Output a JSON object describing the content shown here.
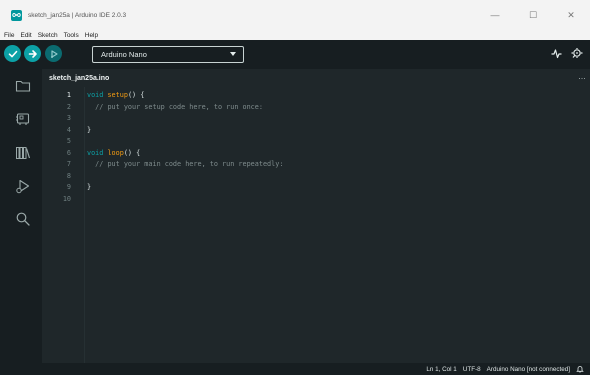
{
  "window": {
    "title": "sketch_jan25a | Arduino IDE 2.0.3",
    "controls": {
      "minimize": "—",
      "maximize": "☐",
      "close": "✕"
    }
  },
  "menu": [
    "File",
    "Edit",
    "Sketch",
    "Tools",
    "Help"
  ],
  "toolbar": {
    "board": "Arduino Nano",
    "icons": [
      "verify-icon",
      "upload-icon",
      "debug-icon",
      "serial-plotter-icon",
      "serial-monitor-icon"
    ]
  },
  "sidebar": {
    "icons": [
      "folder-icon",
      "board-manager-icon",
      "library-icon",
      "debug-run-icon",
      "search-icon"
    ]
  },
  "editor": {
    "tab": "sketch_jan25a.ino",
    "more": "…",
    "lines": [
      {
        "no": "1",
        "active": true,
        "parts": [
          {
            "t": "void",
            "c": "kw"
          },
          {
            "t": " ",
            "c": ""
          },
          {
            "t": "setup",
            "c": "fn"
          },
          {
            "t": "() {",
            "c": ""
          }
        ]
      },
      {
        "no": "2",
        "active": false,
        "parts": [
          {
            "t": "  // put your setup code here, to run once:",
            "c": "cm"
          }
        ]
      },
      {
        "no": "3",
        "active": false,
        "parts": []
      },
      {
        "no": "4",
        "active": false,
        "parts": [
          {
            "t": "}",
            "c": ""
          }
        ]
      },
      {
        "no": "5",
        "active": false,
        "parts": []
      },
      {
        "no": "6",
        "active": false,
        "parts": [
          {
            "t": "void",
            "c": "kw"
          },
          {
            "t": " ",
            "c": ""
          },
          {
            "t": "loop",
            "c": "fn"
          },
          {
            "t": "() {",
            "c": ""
          }
        ]
      },
      {
        "no": "7",
        "active": false,
        "parts": [
          {
            "t": "  // put your main code here, to run repeatedly:",
            "c": "cm"
          }
        ]
      },
      {
        "no": "8",
        "active": false,
        "parts": []
      },
      {
        "no": "9",
        "active": false,
        "parts": [
          {
            "t": "}",
            "c": ""
          }
        ]
      },
      {
        "no": "10",
        "active": false,
        "parts": []
      }
    ]
  },
  "status": {
    "position": "Ln 1, Col 1",
    "encoding": "UTF-8",
    "board": "Arduino Nano [not connected]"
  },
  "colors": {
    "accent": "#0ca1a6",
    "background": "#171e21",
    "editor_bg": "#1f272a",
    "function": "#f39c12"
  }
}
